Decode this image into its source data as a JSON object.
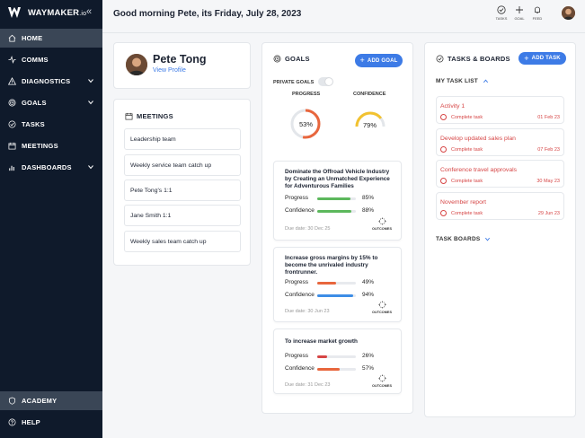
{
  "brand": {
    "name": "WAYMAKER",
    "suffix": ".io"
  },
  "sidebar": {
    "items": [
      {
        "label": "HOME",
        "icon": "home-icon"
      },
      {
        "label": "COMMS",
        "icon": "pulse-icon"
      },
      {
        "label": "DIAGNOSTICS",
        "icon": "warning-icon"
      },
      {
        "label": "GOALS",
        "icon": "target-icon"
      },
      {
        "label": "TASKS",
        "icon": "check-circle-icon"
      },
      {
        "label": "MEETINGS",
        "icon": "calendar-icon"
      },
      {
        "label": "DASHBOARDS",
        "icon": "bar-chart-icon"
      }
    ],
    "bottom": [
      {
        "label": "ACADEMY",
        "icon": "shield-icon"
      },
      {
        "label": "HELP",
        "icon": "help-icon"
      }
    ]
  },
  "header": {
    "greeting": "Good morning Pete, its Friday, July 28, 2023",
    "actions": [
      "TASKS",
      "GOAL",
      "FEED"
    ]
  },
  "profile": {
    "name": "Pete Tong",
    "link": "View Profile"
  },
  "meetings": {
    "title": "MEETINGS",
    "items": [
      "Leadership team",
      "Weekly service team catch up",
      "Pete Tong's 1:1",
      "Jane Smith 1:1",
      "Weekly sales team catch up"
    ]
  },
  "goals": {
    "title": "GOALS",
    "add_label": "ADD GOAL",
    "private_label": "PRIVATE GOALS",
    "progress_label": "PROGRESS",
    "confidence_label": "CONFIDENCE",
    "progress_value": "53%",
    "confidence_value": "79%",
    "progress_fraction": 0.53,
    "confidence_fraction": 0.79,
    "outcomes_label": "OUTCOMES",
    "progress_metric": "Progress",
    "confidence_metric": "Confidence",
    "cards": [
      {
        "title": "Dominate the Offroad Vehicle Industry by Creating an Unmatched Experience for Adventurous Families",
        "progress": "85%",
        "confidence": "88%",
        "progress_fraction": 0.85,
        "confidence_fraction": 0.88,
        "progress_color": "#5cb85c",
        "confidence_color": "#5cb85c",
        "due": "Due date: 30 Dec 25"
      },
      {
        "title": "Increase gross margins by 15% to become the unrivaled industry frontrunner.",
        "progress": "49%",
        "confidence": "94%",
        "progress_fraction": 0.49,
        "confidence_fraction": 0.94,
        "progress_color": "#e8663d",
        "confidence_color": "#3d8de6",
        "due": "Due date: 30 Jun 23"
      },
      {
        "title": "To increase market growth",
        "progress": "26%",
        "confidence": "57%",
        "progress_fraction": 0.26,
        "confidence_fraction": 0.57,
        "progress_color": "#d64545",
        "confidence_color": "#e8663d",
        "due": "Due date: 31 Dec 23"
      }
    ]
  },
  "tasks": {
    "title": "TASKS & BOARDS",
    "add_label": "ADD TASK",
    "my_list": "MY TASK LIST",
    "boards": "TASK BOARDS",
    "complete_label": "Complete task",
    "items": [
      {
        "title": "Activity 1",
        "date": "01 Feb 23"
      },
      {
        "title": "Develop updated sales plan",
        "date": "07 Feb 23"
      },
      {
        "title": "Conference travel approvals",
        "date": "30 May 23"
      },
      {
        "title": "November report",
        "date": "29 Jun 23"
      }
    ]
  },
  "colors": {
    "sidebar": "#0f1a2b",
    "accent": "#3d7be6",
    "overdue": "#d64545"
  }
}
